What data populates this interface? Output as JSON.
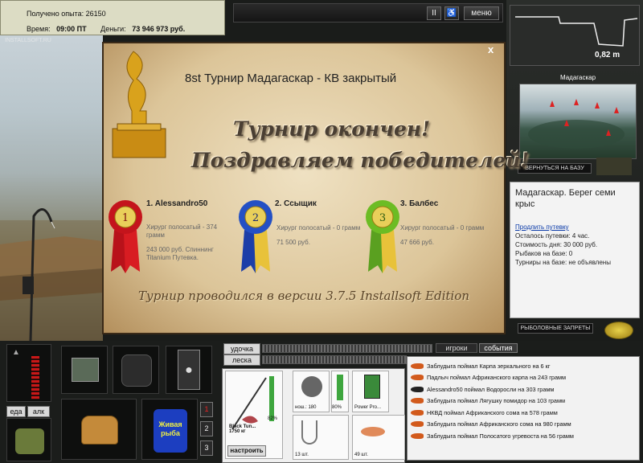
{
  "info": {
    "xp_label": "Получено опыта:",
    "xp_value": "26150",
    "time_label": "Время:",
    "time_value": "09:00 ПТ",
    "money_label": "Деньги:",
    "money_value": "73 946 973 руб."
  },
  "watermark": "INSTALLSOFT.RU",
  "topbar": {
    "pause": "II",
    "menu": "меню"
  },
  "depth": {
    "value": "0,82 m"
  },
  "map": {
    "title": "Мадагаскар",
    "back_button": "ВЕРНУТЬСЯ НА БАЗУ"
  },
  "location": {
    "title": "Мадагаскар. Берег семи крыс",
    "extend_link": "Продлить путевку",
    "days_left": "Осталось путевки: 4 час.",
    "day_cost": "Стоимость дня: 30 000 руб.",
    "fishers": "Рыбаков на базе: 0",
    "tournaments": "Турниры на базе: не объявлены"
  },
  "bans_button": "РЫБОЛОВНЫЕ ЗАПРЕТЫ",
  "modal": {
    "title": "8st Турнир Мадагаскар - КВ закрытый",
    "ended": "Турнир окончен!",
    "congrats": "Поздравляем победителей!",
    "winners": [
      {
        "place": "1",
        "name": "1. Alessandro50",
        "fish": "Хирург полосатый - 374 грамм",
        "prize": "243 000 руб. Спиннинг Titanium Путевка."
      },
      {
        "place": "2",
        "name": "2. Ссыщик",
        "fish": "Хирург полосатый - 0 грамм",
        "prize": "71 500 руб."
      },
      {
        "place": "3",
        "name": "3. Балбес",
        "fish": "Хирург полосатый - 0 грамм",
        "prize": "47 666 руб."
      }
    ],
    "version": "Турнир проводился в версии 3.7.5 Installsoft Edition",
    "close": "x"
  },
  "hud": {
    "food_label": "еда",
    "alc_label": "алк",
    "bait_can": "Живая рыба",
    "rod_label": "удочка",
    "line_label": "леска",
    "tab_players": "игроки",
    "tab_events": "события",
    "side_buttons": [
      "1",
      "2",
      "3"
    ],
    "rod_name": "Black Tun... 1750 кг",
    "fish_pct": "82%",
    "reel_stats": "нош.: 180",
    "reel_pct": "80%",
    "lure_name": "Power Pro...",
    "hook_count": "13 шт.",
    "bait_count": "49 шт.",
    "setup_button": "настроить"
  },
  "catch_log": [
    "Заблудыга поймал Карпа зеркального на 6 кг",
    "Падлыч поймал Африканского карпа на 243 грамм",
    "Alessandro50 поймал Водоросли на 303 грамм",
    "Заблудыга поймал Лягушку помидор на 103 грамм",
    "НКВД поймал Африканского сома на 578 грамм",
    "Заблудыга поймал Африканского сома на 980 грамм",
    "Заблудыга поймал Полосатого угревоста на 56 грамм"
  ]
}
